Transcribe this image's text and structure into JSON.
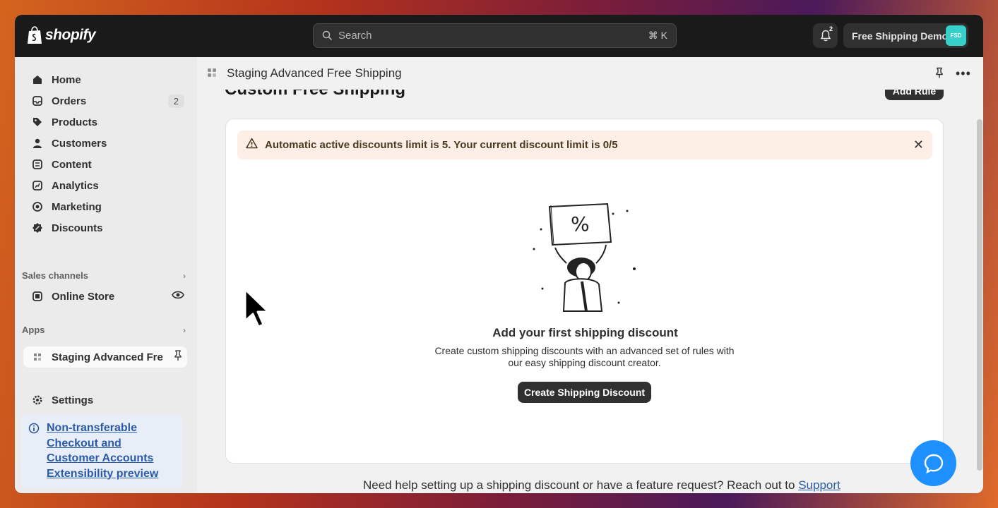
{
  "topbar": {
    "logo_text": "shopify",
    "search_placeholder": "Search",
    "search_shortcut": "⌘ K",
    "notification_count": "2",
    "store_name": "Free Shipping Demo",
    "avatar_initials": "FSD"
  },
  "sidebar": {
    "items": [
      {
        "label": "Home",
        "icon": "home-icon"
      },
      {
        "label": "Orders",
        "icon": "orders-icon",
        "count": "2"
      },
      {
        "label": "Products",
        "icon": "tag-icon"
      },
      {
        "label": "Customers",
        "icon": "person-icon"
      },
      {
        "label": "Content",
        "icon": "content-icon"
      },
      {
        "label": "Analytics",
        "icon": "chart-icon"
      },
      {
        "label": "Marketing",
        "icon": "target-icon"
      },
      {
        "label": "Discounts",
        "icon": "discount-icon"
      }
    ],
    "sales_channels_label": "Sales channels",
    "online_store_label": "Online Store",
    "apps_label": "Apps",
    "active_app_label": "Staging Advanced Fre",
    "settings_label": "Settings",
    "notice_text": "Non-transferable Checkout and Customer Accounts Extensibility preview"
  },
  "main": {
    "app_title": "Staging Advanced Free Shipping",
    "page_title": "Custom Free Shipping",
    "add_rule_label": "Add Rule",
    "banner_text": "Automatic active discounts limit is 5. Your current discount limit is 0/5",
    "empty_title": "Add your first shipping discount",
    "empty_description": "Create custom shipping discounts with an advanced set of rules with our easy shipping discount creator.",
    "create_button_label": "Create Shipping Discount",
    "help_text": "Need help setting up a shipping discount or have a feature request? Reach out to ",
    "help_link": "Support"
  },
  "colors": {
    "topbar_bg": "#1a1a1a",
    "banner_bg": "#fdeee6",
    "link": "#2a5ba8",
    "chat_button": "#1e90ff",
    "avatar_bg": "#36cfc9"
  }
}
